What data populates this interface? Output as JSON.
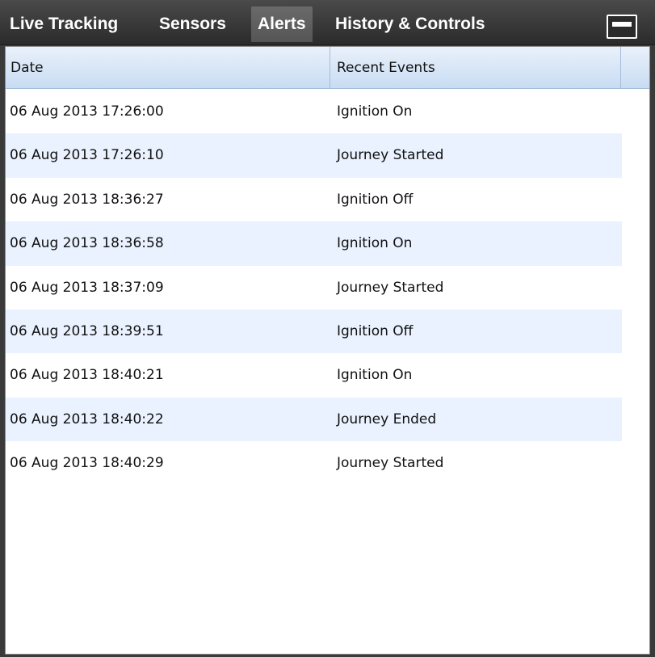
{
  "tabs": [
    {
      "label": "Live Tracking"
    },
    {
      "label": "Sensors"
    },
    {
      "label": "Alerts",
      "active": true
    },
    {
      "label": "History & Controls"
    }
  ],
  "window_controls": {
    "minimize_icon": "minimize-icon"
  },
  "grid": {
    "columns": [
      "Date",
      "Recent Events"
    ],
    "rows": [
      {
        "date": "06 Aug 2013 17:26:00",
        "event": "Ignition On"
      },
      {
        "date": "06 Aug 2013 17:26:10",
        "event": "Journey Started"
      },
      {
        "date": "06 Aug 2013 18:36:27",
        "event": "Ignition Off"
      },
      {
        "date": "06 Aug 2013 18:36:58",
        "event": "Ignition On"
      },
      {
        "date": "06 Aug 2013 18:37:09",
        "event": "Journey Started"
      },
      {
        "date": "06 Aug 2013 18:39:51",
        "event": "Ignition Off"
      },
      {
        "date": "06 Aug 2013 18:40:21",
        "event": "Ignition On"
      },
      {
        "date": "06 Aug 2013 18:40:22",
        "event": "Journey Ended"
      },
      {
        "date": "06 Aug 2013 18:40:29",
        "event": "Journey Started"
      }
    ]
  },
  "colors": {
    "tabbar": "#2b2b2b",
    "active_tab": "#5e5e5e",
    "header": "#d6e5f7",
    "alt_row": "#e9f2fe"
  }
}
